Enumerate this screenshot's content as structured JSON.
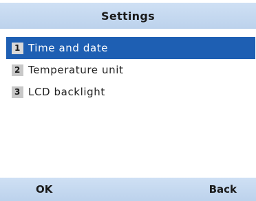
{
  "title": "Settings",
  "menu": {
    "items": [
      {
        "number": "1",
        "label": "Time and date",
        "selected": true
      },
      {
        "number": "2",
        "label": "Temperature unit",
        "selected": false
      },
      {
        "number": "3",
        "label": "LCD backlight",
        "selected": false
      }
    ]
  },
  "softkeys": {
    "left": "OK",
    "right": "Back"
  },
  "colors": {
    "header_bg": "#c4d8f0",
    "selection": "#1e5fb3",
    "badge": "#c8c8c8"
  }
}
